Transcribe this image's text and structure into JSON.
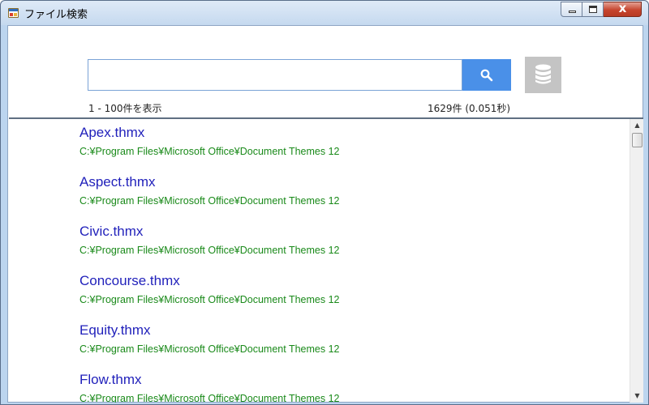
{
  "window": {
    "title": "ファイル検索",
    "close_glyph": "x"
  },
  "search": {
    "value": "",
    "placeholder": "",
    "range_text": "1 - 100件を表示",
    "count_text": "1629件 (0.051秒)"
  },
  "colors": {
    "accent": "#4a90e8",
    "title_link": "#2222bb",
    "path_text": "#1a8a1a",
    "db_button": "#c4c4c4"
  },
  "icons": {
    "search_button": "search-icon",
    "db_button": "database-icon"
  },
  "results": [
    {
      "title": "Apex.thmx",
      "path": "C:¥Program Files¥Microsoft Office¥Document Themes 12"
    },
    {
      "title": "Aspect.thmx",
      "path": "C:¥Program Files¥Microsoft Office¥Document Themes 12"
    },
    {
      "title": "Civic.thmx",
      "path": "C:¥Program Files¥Microsoft Office¥Document Themes 12"
    },
    {
      "title": "Concourse.thmx",
      "path": "C:¥Program Files¥Microsoft Office¥Document Themes 12"
    },
    {
      "title": "Equity.thmx",
      "path": "C:¥Program Files¥Microsoft Office¥Document Themes 12"
    },
    {
      "title": "Flow.thmx",
      "path": "C:¥Program Files¥Microsoft Office¥Document Themes 12"
    }
  ]
}
